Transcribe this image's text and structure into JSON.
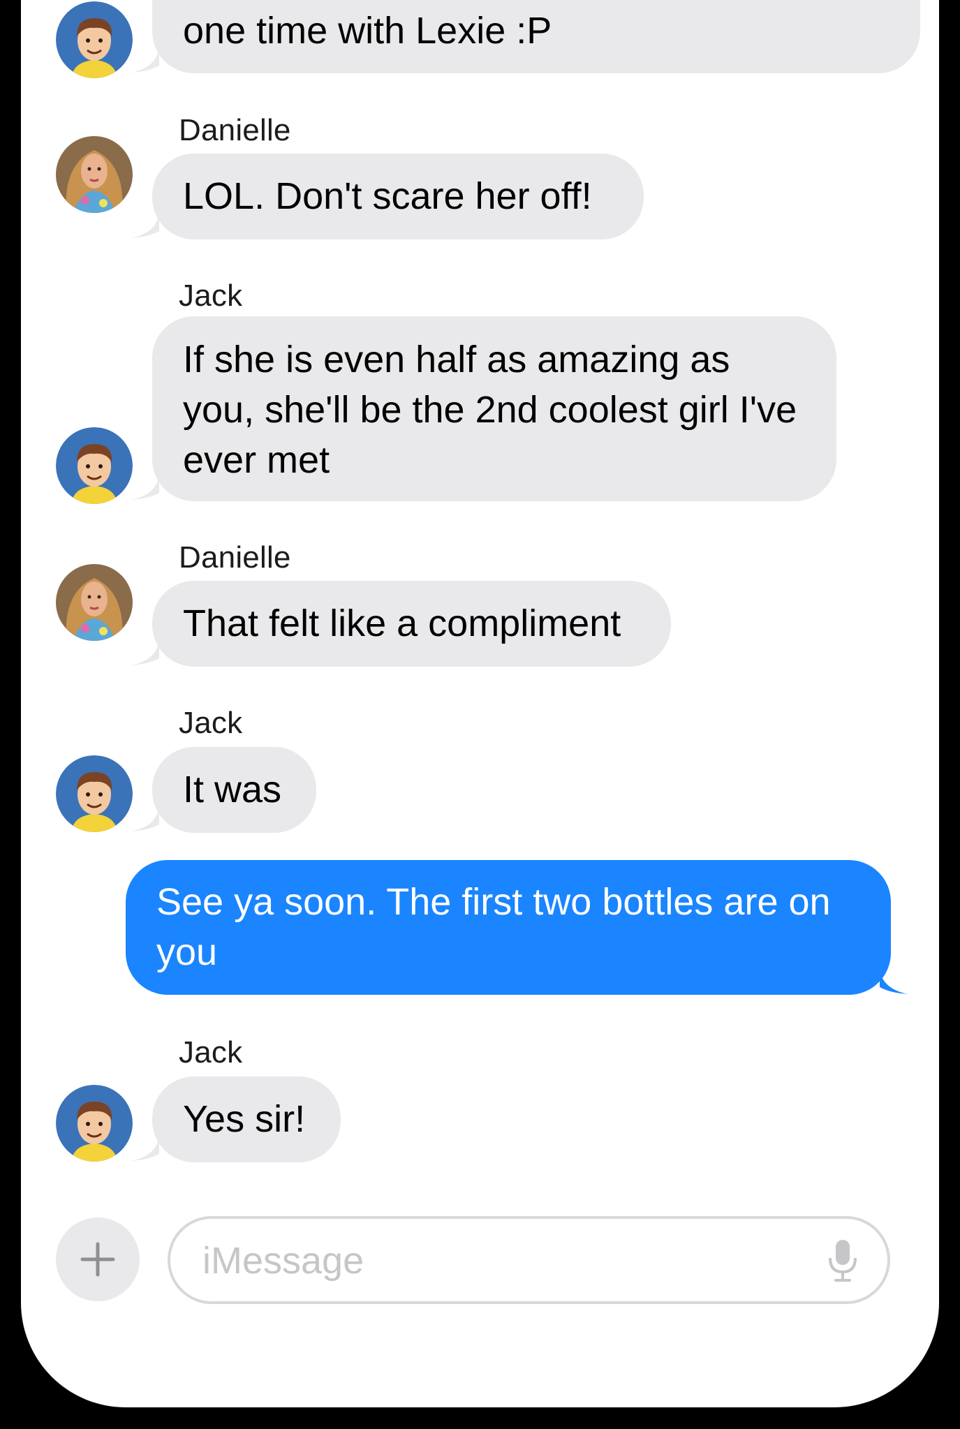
{
  "messages": [
    {
      "sender": "",
      "text": "one time with Lexie :P",
      "direction": "in"
    },
    {
      "sender": "Danielle",
      "text": "LOL.  Don't scare her off!",
      "direction": "in"
    },
    {
      "sender": "Jack",
      "text": "If she is even half as amazing as you, she'll be the 2nd coolest girl I've ever met",
      "direction": "in"
    },
    {
      "sender": "Danielle",
      "text": "That felt like a compliment",
      "direction": "in"
    },
    {
      "sender": "Jack",
      "text": "It was",
      "direction": "in"
    },
    {
      "sender": "",
      "text": "See ya soon.  The first two bottles are on you",
      "direction": "out"
    },
    {
      "sender": "Jack",
      "text": "Yes sir!",
      "direction": "in"
    }
  ],
  "composer": {
    "placeholder": "iMessage",
    "plus_icon": "plus-icon",
    "mic_icon": "microphone-icon"
  },
  "colors": {
    "incoming_bubble": "#e9e9eb",
    "outgoing_bubble": "#1a85ff",
    "frame": "#000000"
  }
}
